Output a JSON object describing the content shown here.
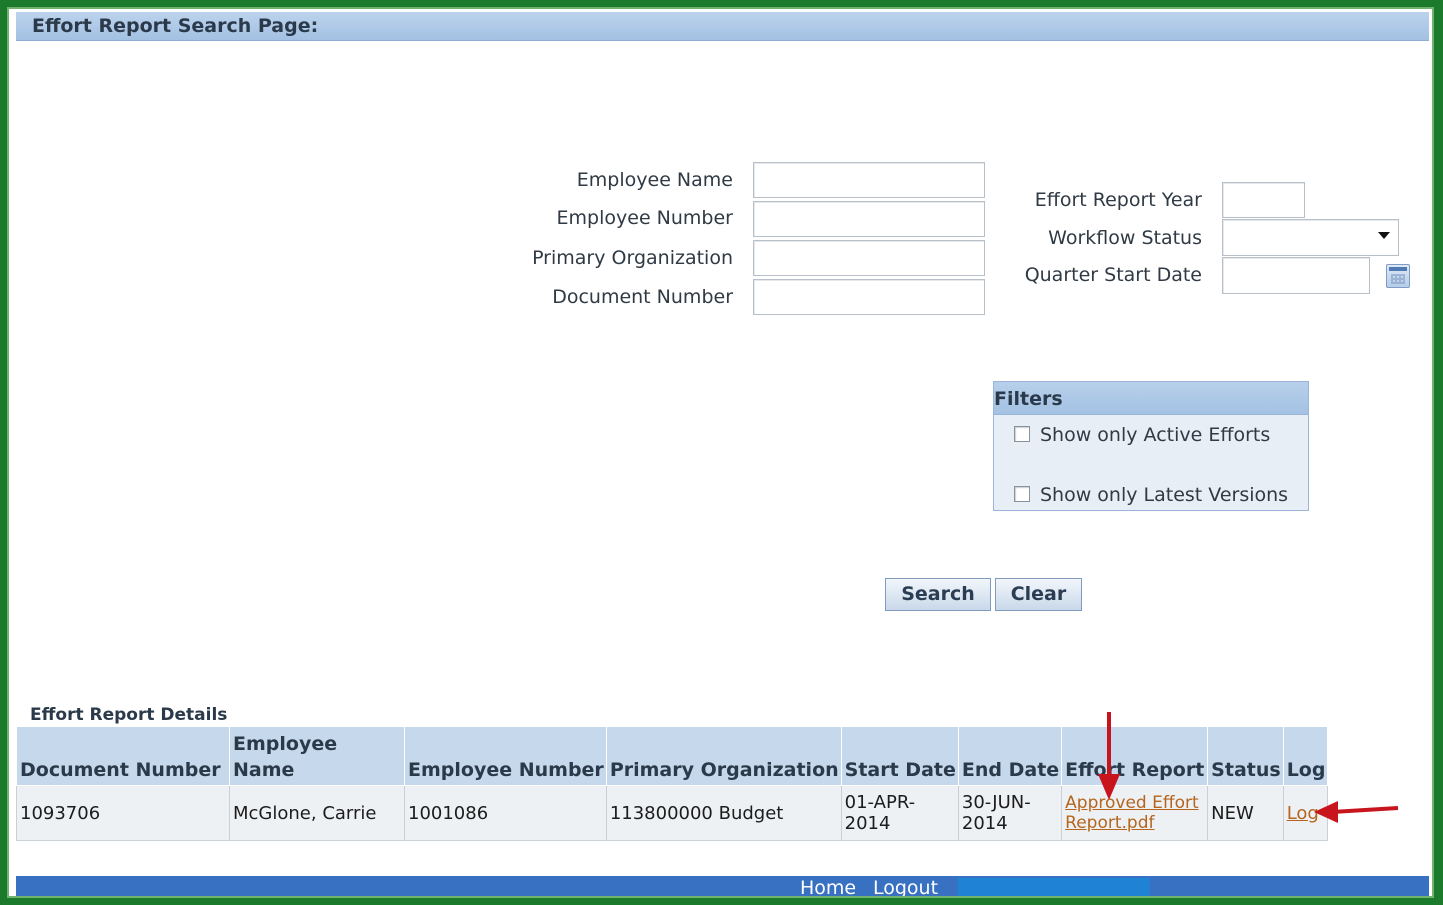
{
  "header": {
    "title": "Effort Report Search Page:"
  },
  "search": {
    "employee_name": {
      "label": "Employee Name",
      "value": ""
    },
    "employee_number": {
      "label": "Employee Number",
      "value": ""
    },
    "primary_organization": {
      "label": "Primary Organization",
      "value": ""
    },
    "document_number": {
      "label": "Document Number",
      "value": ""
    },
    "effort_report_year": {
      "label": "Effort Report Year",
      "value": ""
    },
    "workflow_status": {
      "label": "Workflow Status",
      "value": ""
    },
    "quarter_start_date": {
      "label": "Quarter Start Date",
      "value": ""
    }
  },
  "filters": {
    "title": "Filters",
    "active_efforts": {
      "label": "Show only Active Efforts",
      "checked": false
    },
    "latest_versions": {
      "label": "Show only Latest Versions",
      "checked": false
    }
  },
  "buttons": {
    "search": "Search",
    "clear": "Clear"
  },
  "results": {
    "title": "Effort Report Details",
    "columns": {
      "document_number": "Document Number",
      "employee_name_1": "Employee",
      "employee_name_2": "Name",
      "employee_number": "Employee Number",
      "primary_organization": "Primary Organization",
      "start_date": "Start Date",
      "end_date": "End Date",
      "effort_report": "Effort Report",
      "status": "Status",
      "log": "Log"
    },
    "rows": [
      {
        "document_number": "1093706",
        "employee_name": "McGlone, Carrie",
        "employee_number": "1001086",
        "primary_organization": "113800000 Budget",
        "start_date_1": "01-APR-",
        "start_date_2": "2014",
        "end_date_1": "30-JUN-",
        "end_date_2": "2014",
        "effort_report_1": "Approved Effort",
        "effort_report_2": "Report.pdf",
        "status": "NEW",
        "log": "Log"
      }
    ]
  },
  "footer": {
    "home": "Home",
    "logout": "Logout"
  },
  "colors": {
    "frame": "#1b7a2c",
    "header_bg": "#a3c1e3",
    "link": "#b5651d",
    "footer_bg": "#3871c2",
    "annotation_arrow": "#c8141c"
  }
}
